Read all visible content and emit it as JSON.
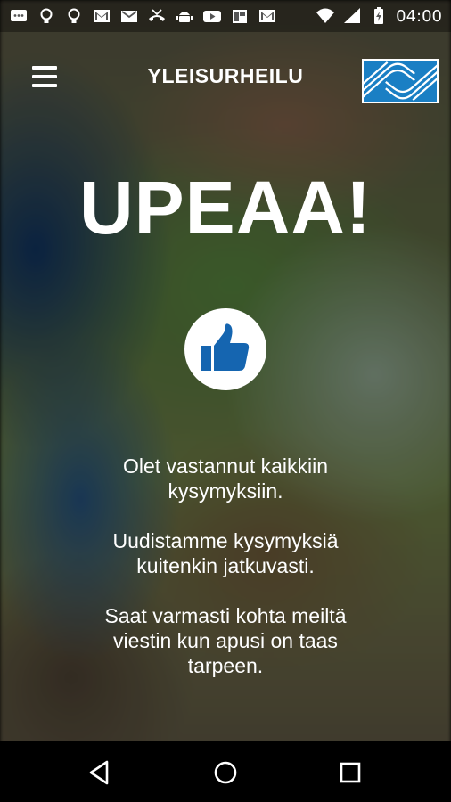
{
  "status_bar": {
    "time": "04:00",
    "left_icons": [
      "chat-icon",
      "lightbulb-icon",
      "lightbulb-icon",
      "gmail-icon",
      "mail-icon",
      "missed-call-icon",
      "android-icon",
      "youtube-icon",
      "flipboard-icon",
      "gmail-icon"
    ],
    "right_icons": [
      "wifi-icon",
      "signal-icon",
      "battery-charging-icon"
    ]
  },
  "header": {
    "title": "YLEISURHEILU",
    "logo_color": "#1a7fc4"
  },
  "main": {
    "headline": "UPEAA!",
    "icon": "thumbs-up-icon",
    "icon_color": "#1565b0",
    "messages": {
      "m1_l1": "Olet vastannut kaikkiin",
      "m1_l2": "kysymyksiin.",
      "m2_l1": "Uudistamme kysymyksiä",
      "m2_l2": "kuitenkin jatkuvasti.",
      "m3_l1": "Saat varmasti kohta meiltä",
      "m3_l2": "viestin kun apusi on taas",
      "m3_l3": "tarpeen."
    }
  },
  "nav_bar": {
    "buttons": [
      "back-icon",
      "home-icon",
      "recents-icon"
    ]
  }
}
